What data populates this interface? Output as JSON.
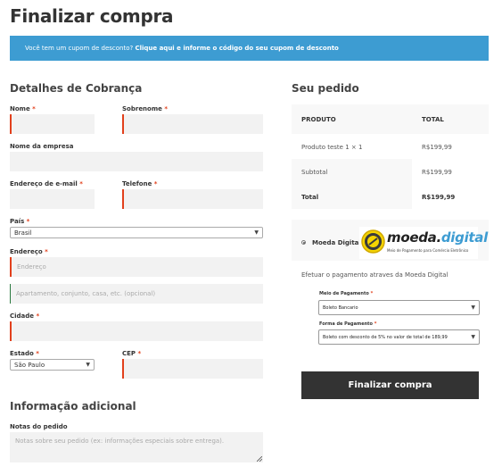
{
  "page": {
    "title": "Finalizar compra"
  },
  "coupon": {
    "text": "Você tem um cupom de desconto?",
    "link": "Clique aqui e informe o código do seu cupom de desconto"
  },
  "billing": {
    "heading": "Detalhes de Cobrança",
    "first_name": "Nome",
    "last_name": "Sobrenome",
    "company": "Nome da empresa",
    "email": "Endereço de e-mail",
    "phone": "Telefone",
    "country_label": "País",
    "country_value": "Brasil",
    "address_label": "Endereço",
    "address_placeholder": "Endereço",
    "address2_placeholder": "Apartamento, conjunto, casa, etc. (opcional)",
    "city": "Cidade",
    "state_label": "Estado",
    "state_value": "São Paulo",
    "cep": "CEP",
    "required_mark": "*"
  },
  "additional": {
    "heading": "Informação adicional",
    "notes_label": "Notas do pedido",
    "notes_placeholder": "Notas sobre seu pedido (ex: informações especiais sobre entrega)."
  },
  "order": {
    "heading": "Seu pedido",
    "col_product": "PRODUTO",
    "col_total": "TOTAL",
    "item_name": "Produto teste 1",
    "item_qty": "× 1",
    "item_total": "R$199,99",
    "subtotal_label": "Subtotal",
    "subtotal_value": "R$199,99",
    "total_label": "Total",
    "total_value": "R$199,99"
  },
  "payment": {
    "method_label": "Moeda Digital",
    "logo_main": "moeda.",
    "logo_accent": "digital",
    "logo_sub": "Meio de Pagamento para Comércio Eletrônico",
    "description": "Efetuar o pagamento atraves da Moeda Digital",
    "means_label": "Meio de Pagamento",
    "means_value": "Boleto Bancario",
    "form_label": "Forma de Pagamento",
    "form_value": "Boleto com desconto de 5% no valor de total de 189,99",
    "submit": "Finalizar compra"
  },
  "colors": {
    "banner": "#3d9cd2",
    "required": "#e2401c",
    "button": "#333333"
  }
}
